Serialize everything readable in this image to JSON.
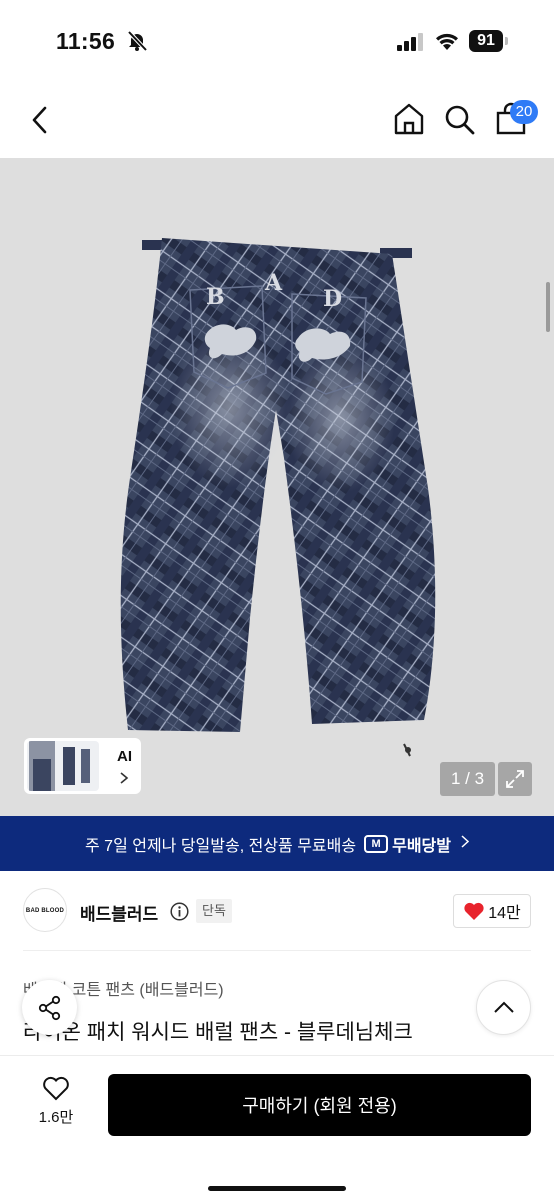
{
  "status_bar": {
    "time": "11:56",
    "battery": "91",
    "icons": [
      "bell-slash-icon",
      "signal-icon",
      "wifi-icon",
      "battery-icon"
    ]
  },
  "nav": {
    "cart_count": "20",
    "icons": [
      "back-icon",
      "home-icon",
      "search-icon",
      "bag-icon"
    ]
  },
  "gallery": {
    "ai_label": "AI",
    "page_indicator": "1 / 3",
    "product_image_logo": "BAD"
  },
  "shipping": {
    "text": "주 7일 언제나 당일발송, 전상품 무료배송",
    "badge": "무배당발"
  },
  "brand": {
    "logo_text": "BAD BLOOD",
    "name": "배드블러드",
    "exclusive": "단독",
    "likes": "14만"
  },
  "product": {
    "category": "베이직 코튼 팬츠 (배드블러드)",
    "title": "라이온 패치 워시드 배럴 팬츠 - 블루데님체크"
  },
  "bottom": {
    "wish_count": "1.6만",
    "buy_label": "구매하기 (회원 전용)"
  },
  "colors": {
    "banner": "#0d2a7d",
    "badge_blue": "#2f7bf6",
    "heart_red": "#e8232c"
  }
}
